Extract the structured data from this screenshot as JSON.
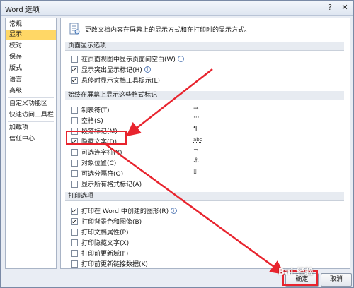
{
  "window": {
    "title": "Word 选项",
    "help_glyph": "?",
    "close_glyph": "✕"
  },
  "sidebar": {
    "items": [
      {
        "label": "常规"
      },
      {
        "label": "显示"
      },
      {
        "label": "校对"
      },
      {
        "label": "保存"
      },
      {
        "label": "版式"
      },
      {
        "label": "语言"
      },
      {
        "label": "高级"
      },
      {
        "label": "自定义功能区"
      },
      {
        "label": "快速访问工具栏"
      },
      {
        "label": "加载项"
      },
      {
        "label": "信任中心"
      }
    ],
    "selected_index": 1
  },
  "main": {
    "intro_text": "更改文档内容在屏幕上的显示方式和在打印时的显示方式。",
    "sections": [
      {
        "header": "页面显示选项",
        "options": [
          {
            "label": "在页面视图中显示页面间空白(W)",
            "checked": false,
            "info": true
          },
          {
            "label": "显示突出显示标记(H)",
            "checked": true,
            "info": true
          },
          {
            "label": "悬停时显示文档工具提示(L)",
            "checked": true,
            "info": false
          }
        ]
      },
      {
        "header": "始终在屏幕上显示这些格式标记",
        "options": [
          {
            "label": "制表符(T)",
            "checked": false,
            "mark": "→"
          },
          {
            "label": "空格(S)",
            "checked": false,
            "mark": "···"
          },
          {
            "label": "段落标记(M)",
            "checked": false,
            "mark": "¶"
          },
          {
            "label": "隐藏文字(D)",
            "checked": true,
            "mark": "abc"
          },
          {
            "label": "可选连字符(Y)",
            "checked": false,
            "mark": "¬"
          },
          {
            "label": "对象位置(C)",
            "checked": false,
            "mark": "⚓"
          },
          {
            "label": "可选分隔符(O)",
            "checked": false,
            "mark": "▯"
          },
          {
            "label": "显示所有格式标记(A)",
            "checked": false,
            "mark": ""
          }
        ]
      },
      {
        "header": "打印选项",
        "options": [
          {
            "label": "打印在 Word 中创建的图形(R)",
            "checked": true,
            "info": true
          },
          {
            "label": "打印背景色和图像(B)",
            "checked": true,
            "info": false
          },
          {
            "label": "打印文档属性(P)",
            "checked": false,
            "info": false
          },
          {
            "label": "打印隐藏文字(X)",
            "checked": false,
            "info": false
          },
          {
            "label": "打印前更新域(F)",
            "checked": false,
            "info": false
          },
          {
            "label": "打印前更新链接数据(K)",
            "checked": false,
            "info": false
          }
        ]
      }
    ]
  },
  "footer": {
    "ok_label": "确定",
    "cancel_label": "取消"
  },
  "annotations": {
    "highlight_color": "#e8242e",
    "watermark_text": "Bai 经验"
  },
  "icons": {
    "intro": "document-display-icon",
    "info": "info-icon",
    "anchor": "anchor-icon"
  }
}
